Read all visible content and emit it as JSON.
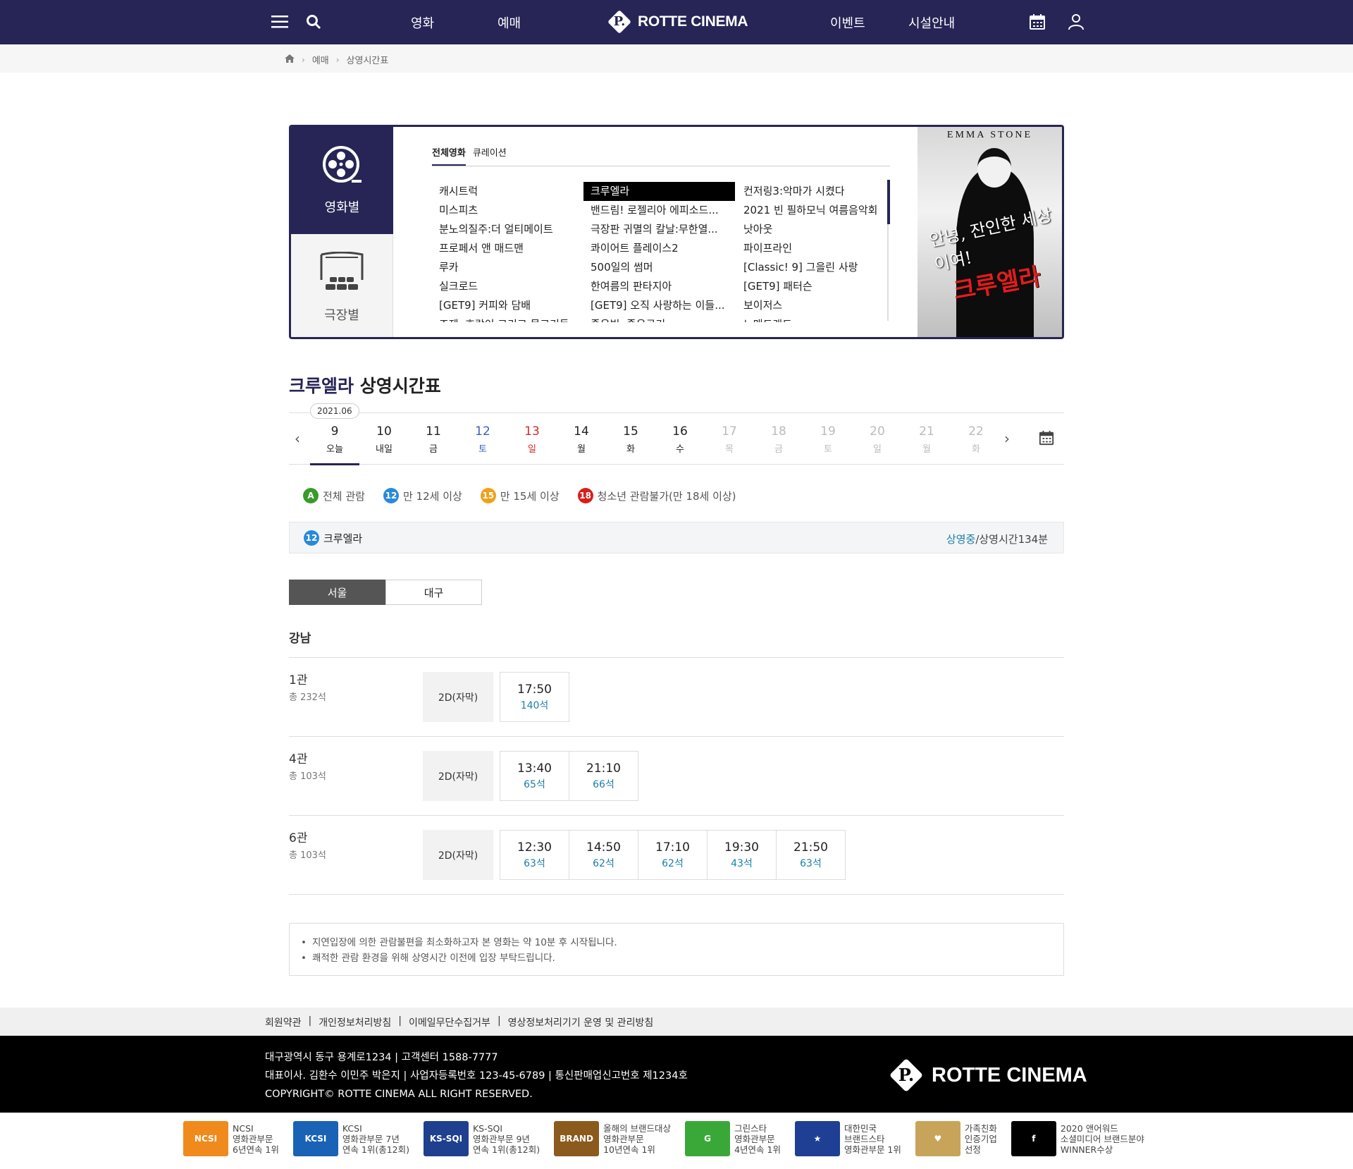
{
  "header": {
    "nav_left": [
      "영화",
      "예매"
    ],
    "brand": "ROTTE CINEMA",
    "logo_letter": "P.",
    "nav_right": [
      "이벤트",
      "시설안내"
    ],
    "bg_color": "#262556"
  },
  "breadcrumb": [
    "예매",
    "상영시간표"
  ],
  "picker": {
    "side_tabs": [
      "영화별",
      "극장별"
    ],
    "list_tabs": [
      "전체영화",
      "큐레이션"
    ],
    "columns": [
      [
        "캐시트럭",
        "미스피츠",
        "분노의질주:더 얼티메이트",
        "프로페서 앤 매드맨",
        "루카",
        "실크로드",
        "[GET9] 커피와 담배",
        "조제, 호랑이 그리고 물고기들"
      ],
      [
        "크루엘라",
        "밴드림! 로젤리아 에피소드...",
        "극장판 귀멸의 칼날:무한열...",
        "콰이어트 플레이스2",
        "500일의 썸머",
        "한여름의 판타지아",
        "[GET9] 오직 사랑하는 이들...",
        "좋은빛, 좋은공기"
      ],
      [
        "컨저링3:악마가 시켰다",
        "2021 빈 필하모닉 여름음악회",
        "낫아웃",
        "파이프라인",
        "[Classic! 9] 그을린 사랑",
        "[GET9] 패터슨",
        "보이저스",
        "노매드랜드"
      ]
    ],
    "selected": "크루엘라",
    "poster": {
      "top_text": "EMMA STONE",
      "slogan": "안녕, 잔인한 세상이여!",
      "title": "크루엘라"
    }
  },
  "schedule": {
    "movie": "크루엘라",
    "title": "상영시간표",
    "month": "2021.06",
    "days": [
      {
        "n": "9",
        "w": "오늘",
        "c": "#222",
        "on": true
      },
      {
        "n": "10",
        "w": "내일",
        "c": "#222"
      },
      {
        "n": "11",
        "w": "금",
        "c": "#222"
      },
      {
        "n": "12",
        "w": "토",
        "c": "#3b5fc0"
      },
      {
        "n": "13",
        "w": "일",
        "c": "#d62828"
      },
      {
        "n": "14",
        "w": "월",
        "c": "#222"
      },
      {
        "n": "15",
        "w": "화",
        "c": "#222"
      },
      {
        "n": "16",
        "w": "수",
        "c": "#222"
      },
      {
        "n": "17",
        "w": "목",
        "c": "#bbb"
      },
      {
        "n": "18",
        "w": "금",
        "c": "#bbb"
      },
      {
        "n": "19",
        "w": "토",
        "c": "#bbb"
      },
      {
        "n": "20",
        "w": "일",
        "c": "#bbb"
      },
      {
        "n": "21",
        "w": "월",
        "c": "#bbb"
      },
      {
        "n": "22",
        "w": "화",
        "c": "#bbb"
      }
    ]
  },
  "grades": [
    {
      "badge": "A",
      "label": "전체 관람"
    },
    {
      "badge": "12",
      "label": "만 12세 이상"
    },
    {
      "badge": "15",
      "label": "만 15세 이상"
    },
    {
      "badge": "18",
      "label": "청소년 관람불가(만 18세 이상)"
    }
  ],
  "movie_row": {
    "badge": "12",
    "name": "크루엘라",
    "status": "상영중",
    "runtime": "/상영시간134분"
  },
  "regions": [
    "서울",
    "대구"
  ],
  "theater": "강남",
  "halls": [
    {
      "name": "1관",
      "seats": "총 232석",
      "format": "2D(자막)",
      "slots": [
        {
          "t": "17:50",
          "s": "140석"
        }
      ]
    },
    {
      "name": "4관",
      "seats": "총 103석",
      "format": "2D(자막)",
      "slots": [
        {
          "t": "13:40",
          "s": "65석"
        },
        {
          "t": "21:10",
          "s": "66석"
        }
      ]
    },
    {
      "name": "6관",
      "seats": "총 103석",
      "format": "2D(자막)",
      "slots": [
        {
          "t": "12:30",
          "s": "63석"
        },
        {
          "t": "14:50",
          "s": "62석"
        },
        {
          "t": "17:10",
          "s": "62석"
        },
        {
          "t": "19:30",
          "s": "43석"
        },
        {
          "t": "21:50",
          "s": "63석"
        }
      ]
    }
  ],
  "notice": [
    "지연입장에 의한 관람불편을 최소화하고자 본 영화는 약 10분 후 시작됩니다.",
    "쾌적한 관람 환경을 위해 상영시간 이전에 입장 부탁드립니다."
  ],
  "footer": {
    "links": [
      "회원약관",
      "개인정보처리방침",
      "이메일무단수집거부",
      "영상정보처리기기 운영 및 관리방침"
    ],
    "lines": [
      "대구광역시 동구 용계로1234  |  고객센터 1588-7777",
      "대표이사. 김환수 이민주 박은지  |  사업자등록번호 123-45-6789  |  통신판매업신고번호 제1234호",
      "COPYRIGHT© ROTTE CINEMA ALL RIGHT RESERVED."
    ],
    "brand": "ROTTE CINEMA",
    "awards": [
      {
        "logo": "NCSI",
        "color": "#f08a1c",
        "text": [
          "NCSI",
          "영화관부문",
          "6년연속 1위"
        ]
      },
      {
        "logo": "KCSI",
        "color": "#1a62b5",
        "text": [
          "KCSI",
          "영화관부문 7년",
          "연속 1위(총12회)"
        ]
      },
      {
        "logo": "KS-SQI",
        "color": "#1f3f8f",
        "text": [
          "KS-SQI",
          "영화관부문 9년",
          "연속 1위(총12회)"
        ]
      },
      {
        "logo": "BRAND",
        "color": "#8b5a1c",
        "text": [
          "올해의 브랜드대상",
          "영화관부문",
          "10년연속 1위"
        ]
      },
      {
        "logo": "G",
        "color": "#3aa838",
        "text": [
          "그린스타",
          "영화관부문",
          "4년연속 1위"
        ]
      },
      {
        "logo": "★",
        "color": "#1e3f93",
        "text": [
          "대한민국",
          "브랜드스타",
          "영화관부문 1위"
        ]
      },
      {
        "logo": "♥",
        "color": "#c8a35a",
        "text": [
          "가족친화",
          "인증기업",
          "선정"
        ]
      },
      {
        "logo": "f",
        "color": "#000000",
        "text": [
          "2020 앤어워드",
          "소셜미디어 브랜드분야",
          "WINNER수상"
        ]
      }
    ]
  }
}
